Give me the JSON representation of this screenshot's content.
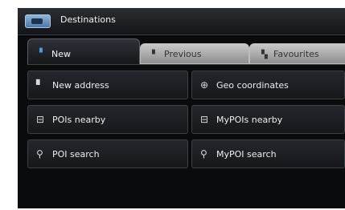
{
  "title": {
    "text": "Destinations",
    "icon": "navigation-app-icon"
  },
  "tabs": [
    {
      "label": "New",
      "icon": "flag-icon",
      "active": true
    },
    {
      "label": "Previous",
      "icon": "flag-icon",
      "active": false
    },
    {
      "label": "Favourites",
      "icon": "favourites-icon",
      "active": false
    }
  ],
  "options": [
    {
      "label": "New address",
      "icon": "flag-icon"
    },
    {
      "label": "Geo coordinates",
      "icon": "compass-icon"
    },
    {
      "label": "POIs nearby",
      "icon": "poi-icon"
    },
    {
      "label": "MyPOIs nearby",
      "icon": "my-poi-icon"
    },
    {
      "label": "POI search",
      "icon": "search-icon"
    },
    {
      "label": "MyPOI search",
      "icon": "my-poi-search-icon"
    }
  ],
  "colors": {
    "accent": "#4e9ee6",
    "background": "#0a0b0d",
    "tab_inactive": "#a8a8a8"
  }
}
